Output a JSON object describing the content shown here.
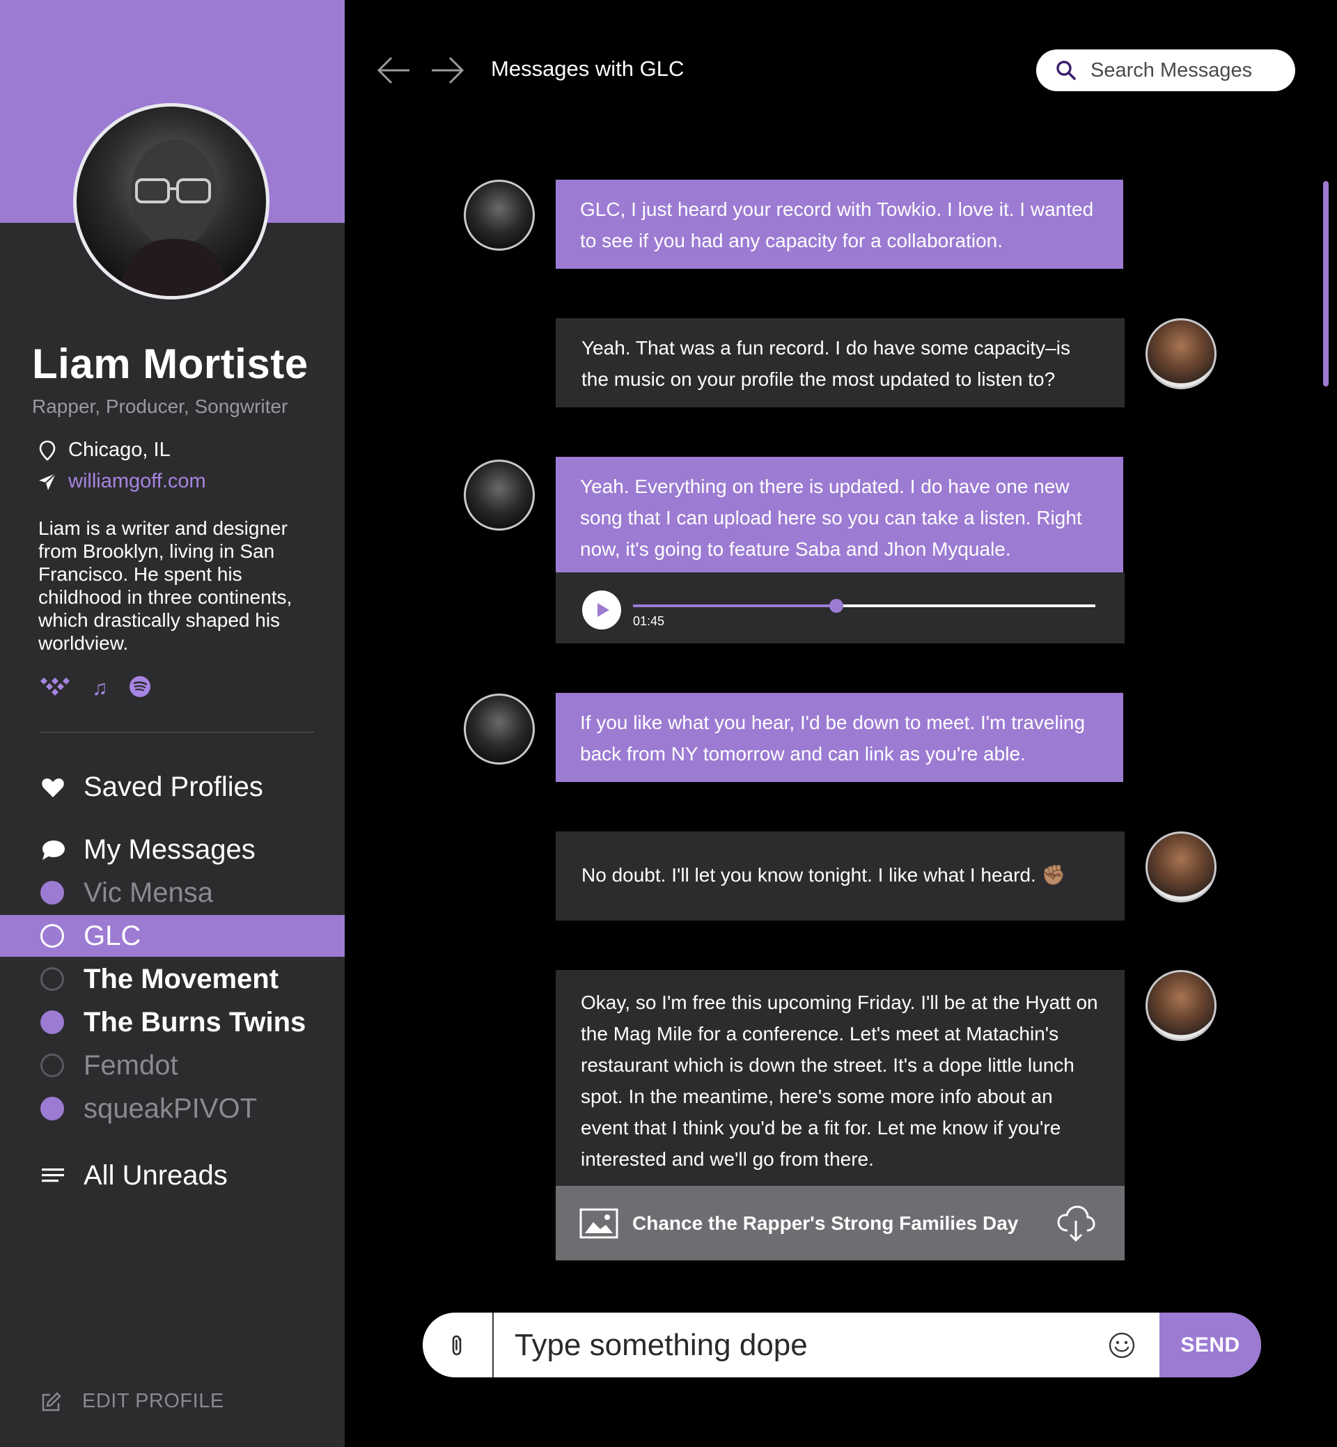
{
  "sidebar": {
    "profile": {
      "name": "Liam Mortiste",
      "role": "Rapper, Producer, Songwriter",
      "location": "Chicago, IL",
      "website": "williamgoff.com",
      "bio": "Liam is a writer and designer from Brooklyn, living in San Francisco. He spent his childhood in three continents, which drastically shaped his worldview.",
      "social_icons": [
        "tidal-icon",
        "apple-music-icon",
        "spotify-icon"
      ]
    },
    "nav": {
      "saved_profiles": "Saved Proflies",
      "my_messages": "My Messages",
      "all_unreads": "All Unreads"
    },
    "conversations": [
      {
        "name": "Vic Mensa",
        "unread": true,
        "active": false
      },
      {
        "name": "GLC",
        "unread": false,
        "active": true
      },
      {
        "name": "The Movement",
        "unread": false,
        "active": false
      },
      {
        "name": "The Burns Twins",
        "unread": true,
        "active": false
      },
      {
        "name": "Femdot",
        "unread": false,
        "active": false
      },
      {
        "name": "squeakPIVOT",
        "unread": true,
        "active": false
      }
    ],
    "edit_profile": "EDIT PROFILE"
  },
  "header": {
    "title": "Messages with GLC",
    "search_placeholder": "Search Messages"
  },
  "messages": [
    {
      "from": "me",
      "text": "GLC, I just heard your record with Towkio. I love it. I wanted to see if you had any capacity for a collaboration."
    },
    {
      "from": "GLC",
      "text": "Yeah. That was a fun record. I do have some capacity–is the music on your profile the most updated to listen to?"
    },
    {
      "from": "me",
      "text": "Yeah. Everything on there is updated. I do have one new song that I can upload here so you can take a listen. Right now, it's going to feature Saba and Jhon Myquale.",
      "audio": {
        "time": "01:45",
        "progress": 0.44
      }
    },
    {
      "from": "me",
      "text": "If you like what you hear, I'd be down to meet. I'm traveling back from NY tomorrow and can link as you're able."
    },
    {
      "from": "GLC",
      "text": "No doubt. I'll let you know tonight. I like what I heard. ✊🏽"
    },
    {
      "from": "GLC",
      "text": "Okay, so I'm free this upcoming Friday. I'll be at the Hyatt on the Mag Mile for a conference. Let's meet at Matachin's restaurant which is down the street. It's a dope little lunch spot. In the meantime, here's some more info about an event that I think you'd be a fit for. Let me know if you're interested and we'll go from there.",
      "attachment": "Chance the Rapper's Strong Families Day"
    }
  ],
  "composer": {
    "placeholder": "Type something dope",
    "send_label": "SEND"
  },
  "colors": {
    "accent": "#9c7bd3",
    "sidebar_bg": "#2c2c2e",
    "background": "#000000"
  }
}
